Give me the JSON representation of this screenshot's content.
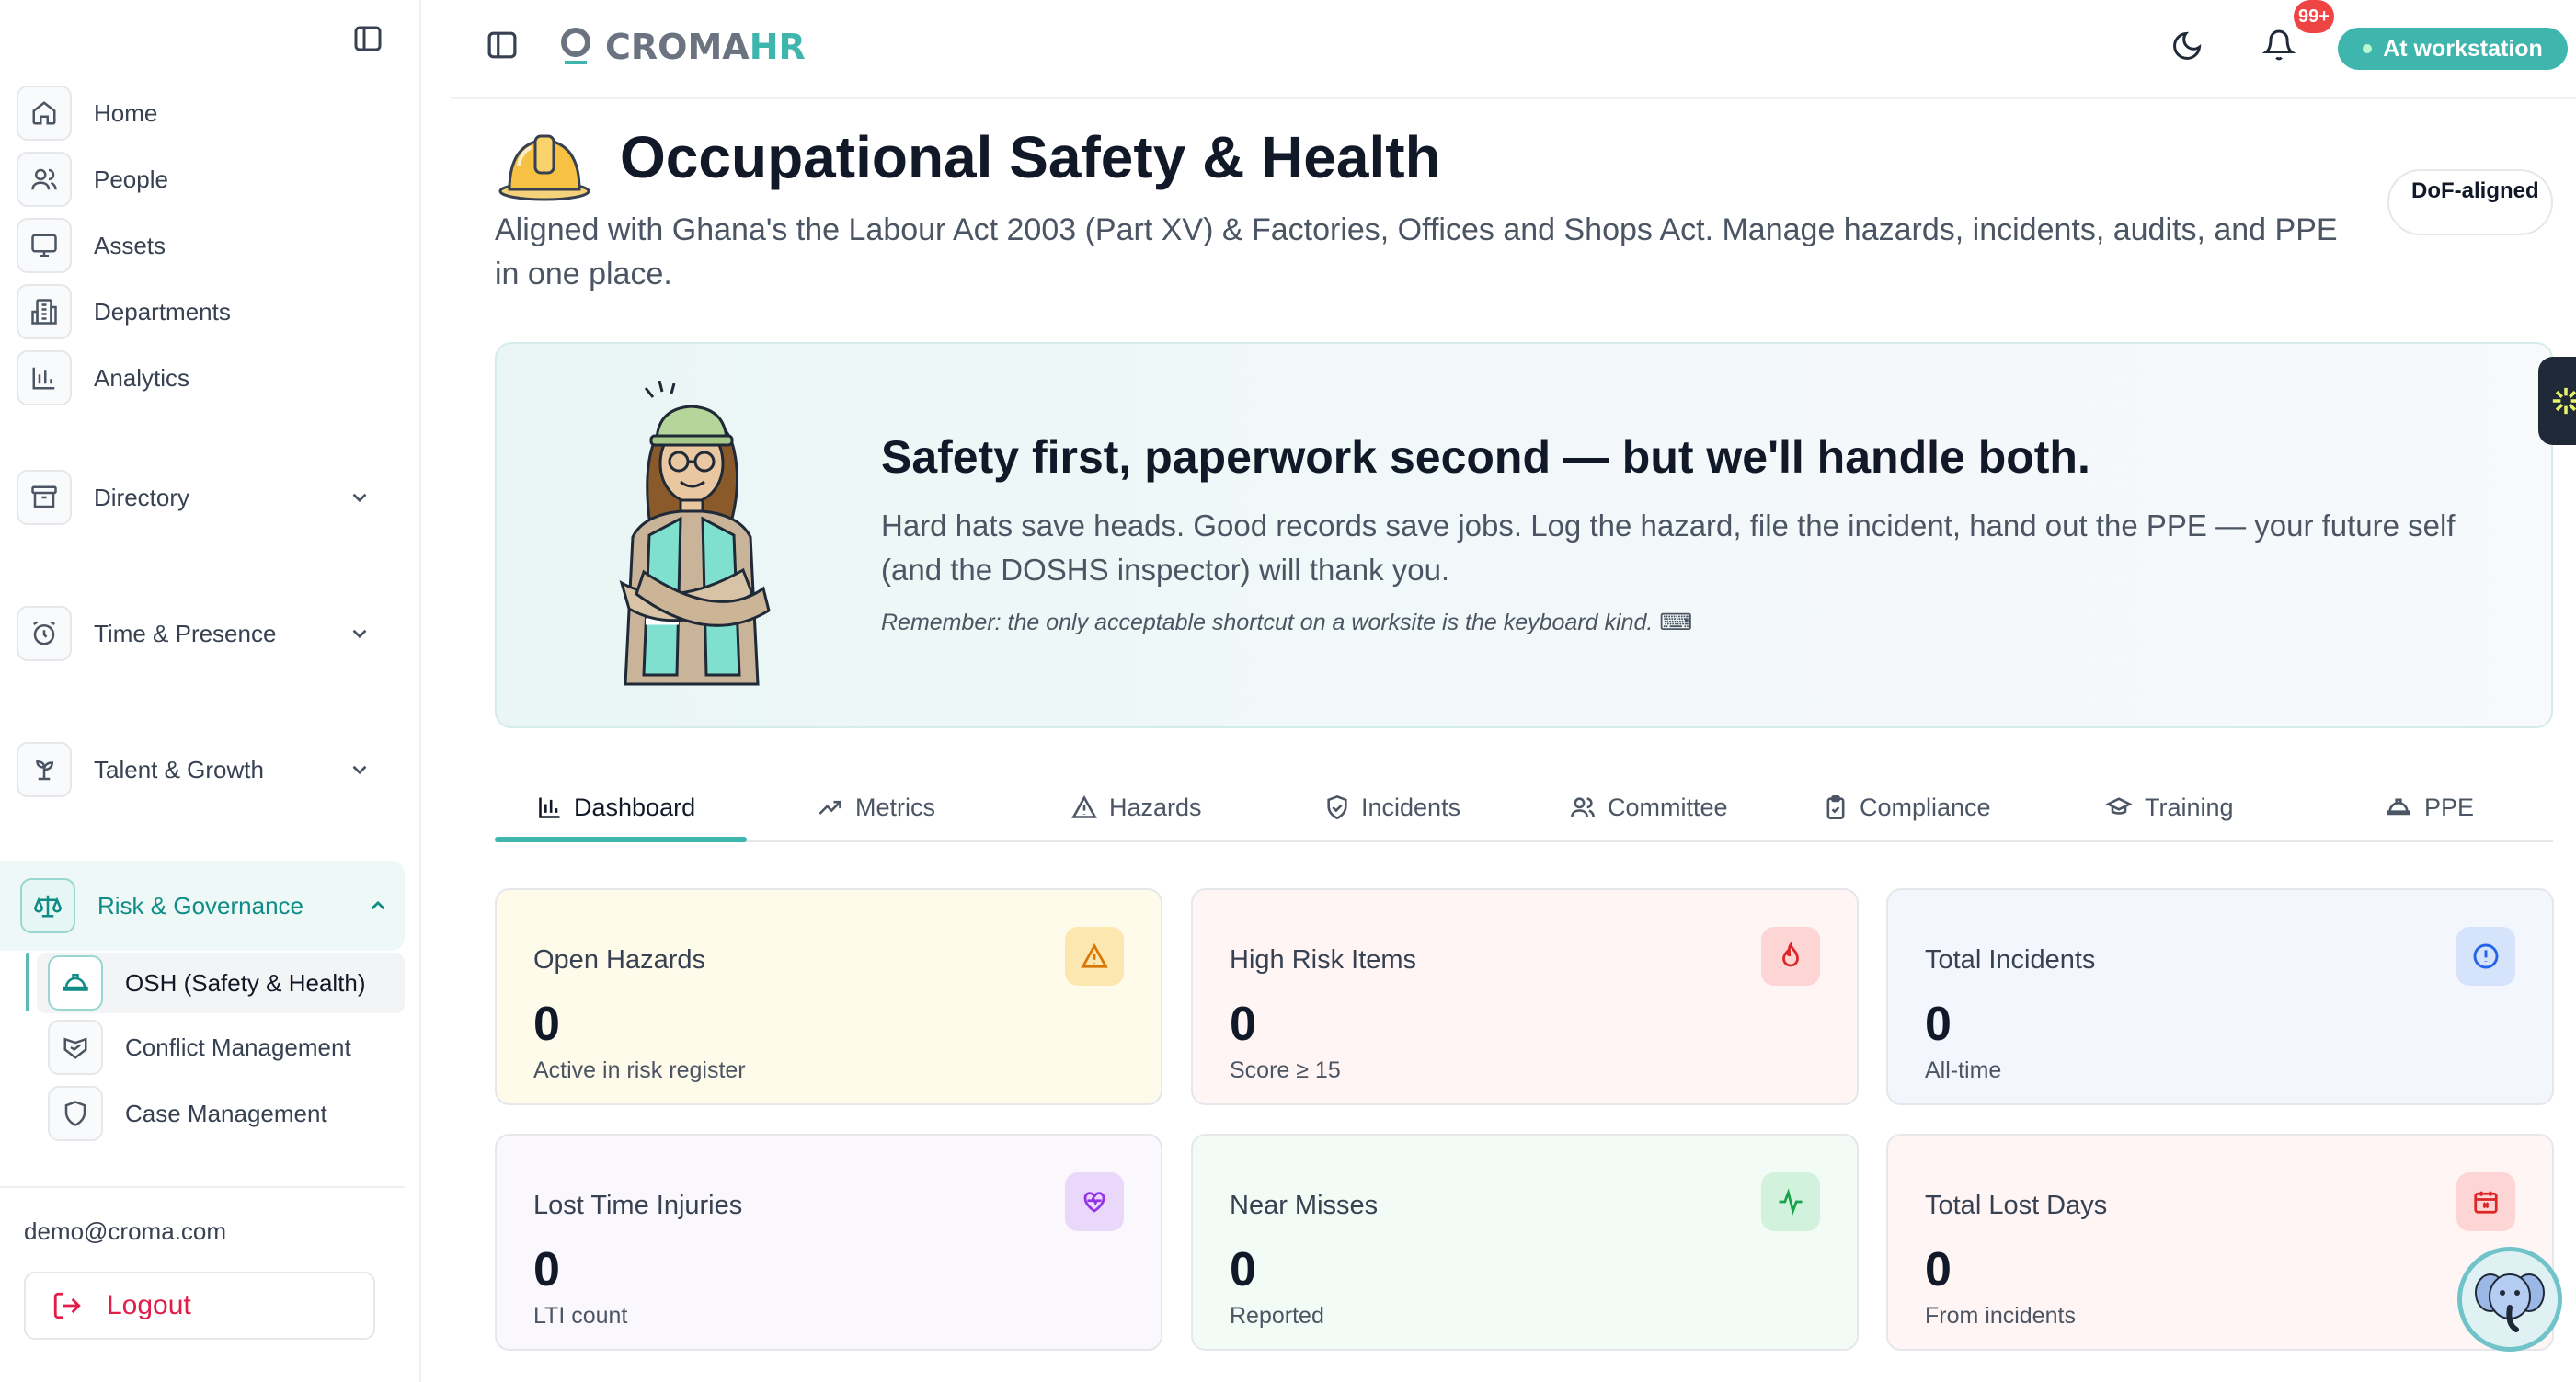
{
  "sidebar": {
    "items": [
      {
        "label": "Home",
        "icon": "home-icon"
      },
      {
        "label": "People",
        "icon": "people-icon"
      },
      {
        "label": "Assets",
        "icon": "monitor-icon"
      },
      {
        "label": "Departments",
        "icon": "building-icon"
      },
      {
        "label": "Analytics",
        "icon": "bar-chart-icon"
      }
    ],
    "groups": [
      {
        "label": "Directory",
        "icon": "archive-icon"
      },
      {
        "label": "Time & Presence",
        "icon": "alarm-clock-icon"
      },
      {
        "label": "Talent & Growth",
        "icon": "sprout-icon"
      },
      {
        "label": "Risk & Governance",
        "icon": "scale-icon"
      }
    ],
    "sub_items": [
      {
        "label": "OSH (Safety & Health)",
        "icon": "hard-hat-icon"
      },
      {
        "label": "Conflict Management",
        "icon": "handshake-icon"
      },
      {
        "label": "Case Management",
        "icon": "shield-icon"
      }
    ],
    "email": "demo@croma.com",
    "logout": "Logout"
  },
  "header": {
    "logo_part1": "CROMA",
    "logo_part2": "HR",
    "notification_count": "99+",
    "status": "At workstation"
  },
  "page": {
    "title": "Occupational Safety & Health",
    "subtitle": "Aligned with Ghana's the Labour Act 2003 (Part XV) & Factories, Offices and Shops Act. Manage hazards, incidents, audits, and PPE in one place.",
    "badge": "DoF-aligned"
  },
  "hero": {
    "title": "Safety first, paperwork second — but we'll handle both.",
    "text": "Hard hats save heads. Good records save jobs. Log the hazard, file the incident, hand out the PPE — your future self (and the DOSHS inspector) will thank you.",
    "note": "Remember: the only acceptable shortcut on a worksite is the keyboard kind. ⌨"
  },
  "tabs": [
    {
      "label": "Dashboard",
      "icon": "bar-chart-icon"
    },
    {
      "label": "Metrics",
      "icon": "trending-up-icon"
    },
    {
      "label": "Hazards",
      "icon": "warning-icon"
    },
    {
      "label": "Incidents",
      "icon": "shield-alert-icon"
    },
    {
      "label": "Committee",
      "icon": "users-icon"
    },
    {
      "label": "Compliance",
      "icon": "clipboard-check-icon"
    },
    {
      "label": "Training",
      "icon": "graduation-cap-icon"
    },
    {
      "label": "PPE",
      "icon": "hard-hat-icon"
    }
  ],
  "cards": [
    {
      "title": "Open Hazards",
      "value": "0",
      "foot": "Active in risk register",
      "bg": "#fffbeb",
      "icon_bg": "#fde7b0",
      "icon_color": "#d97706"
    },
    {
      "title": "High Risk Items",
      "value": "0",
      "foot": "Score ≥ 15",
      "bg": "#fff5f5",
      "icon_bg": "#fdd5d5",
      "icon_color": "#dc2626"
    },
    {
      "title": "Total Incidents",
      "value": "0",
      "foot": "All-time",
      "bg": "#f3f7fd",
      "icon_bg": "#d6e4fb",
      "icon_color": "#2563eb"
    },
    {
      "title": "Lost Time Injuries",
      "value": "0",
      "foot": "LTI count",
      "bg": "#faf7fd",
      "icon_bg": "#ead8fb",
      "icon_color": "#9333ea"
    },
    {
      "title": "Near Misses",
      "value": "0",
      "foot": "Reported",
      "bg": "#f2fbf5",
      "icon_bg": "#d3f2dd",
      "icon_color": "#16a34a"
    },
    {
      "title": "Total Lost Days",
      "value": "0",
      "foot": "From incidents",
      "bg": "#fff5f5",
      "icon_bg": "#fdd5d5",
      "icon_color": "#dc2626"
    }
  ]
}
